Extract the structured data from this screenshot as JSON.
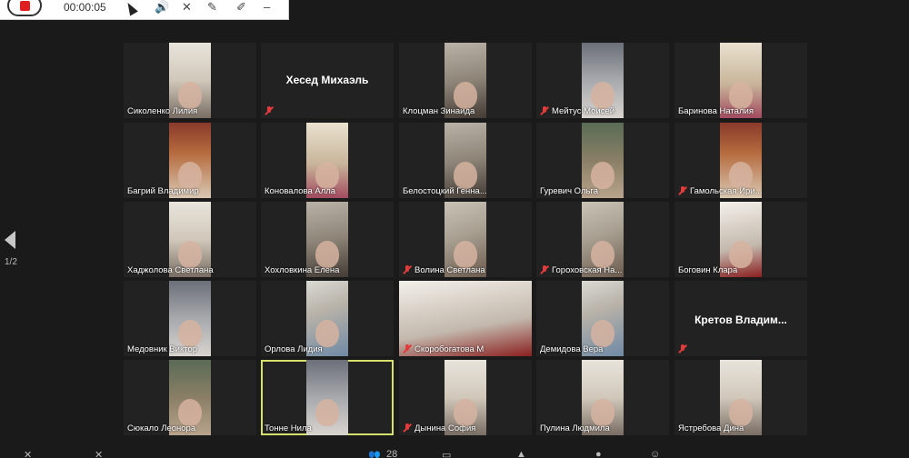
{
  "recording_bar": {
    "timer": "00:00:05",
    "icons": [
      "stop-record-icon",
      "volume-icon",
      "pin-icon",
      "pen-icon",
      "brush-icon",
      "minimize-icon"
    ]
  },
  "pager": {
    "page": "1/2"
  },
  "participants": [
    {
      "name": "Сиколенко Лилия",
      "muted": false,
      "video": "vid-c",
      "vw": 46,
      "vx": 50
    },
    {
      "name": "Хесед Михаэль",
      "muted": true,
      "video": "none",
      "label_center": true
    },
    {
      "name": "Клоцман Зинаида",
      "muted": false,
      "video": "vid-d",
      "vw": 46,
      "vx": 50
    },
    {
      "name": "Мейтус Моисей",
      "muted": true,
      "video": "vid-i",
      "vw": 46,
      "vx": 50
    },
    {
      "name": "Баринова Наталия",
      "muted": false,
      "video": "vid-e",
      "vw": 46,
      "vx": 50
    },
    {
      "name": "Багрий Владимир",
      "muted": false,
      "video": "vid-b",
      "vw": 46,
      "vx": 50
    },
    {
      "name": "Коновалова Алла",
      "muted": false,
      "video": "vid-e",
      "vw": 46,
      "vx": 50
    },
    {
      "name": "Белостоцкий Генна...",
      "muted": false,
      "video": "vid-d",
      "vw": 46,
      "vx": 50
    },
    {
      "name": "Гуревич Ольга",
      "muted": false,
      "video": "vid-h",
      "vw": 46,
      "vx": 50
    },
    {
      "name": "Гамольская Ири...",
      "muted": true,
      "video": "vid-b",
      "vw": 46,
      "vx": 50
    },
    {
      "name": "Хаджолова Светлана",
      "muted": false,
      "video": "vid-c",
      "vw": 46,
      "vx": 50
    },
    {
      "name": "Хохловкина Елена",
      "muted": false,
      "video": "vid-d",
      "vw": 46,
      "vx": 50
    },
    {
      "name": "Волина Светлана",
      "muted": true,
      "video": "vid-a",
      "vw": 46,
      "vx": 50
    },
    {
      "name": "Гороховская На...",
      "muted": true,
      "video": "vid-a",
      "vw": 46,
      "vx": 50
    },
    {
      "name": "Боговин Клара",
      "muted": false,
      "video": "vid-g",
      "vw": 46,
      "vx": 50
    },
    {
      "name": "Медовник Виктор",
      "muted": false,
      "video": "vid-i",
      "vw": 46,
      "vx": 50
    },
    {
      "name": "Орлова Лидия",
      "muted": false,
      "video": "vid-f",
      "vw": 46,
      "vx": 50
    },
    {
      "name": "Скоробогатова М",
      "muted": true,
      "video": "vid-g",
      "vw": 146,
      "vx": 0
    },
    {
      "name": "Демидова Вера",
      "muted": false,
      "video": "vid-f",
      "vw": 46,
      "vx": 50
    },
    {
      "name": "Кретов Владим...",
      "muted": true,
      "video": "none",
      "label_center": true
    },
    {
      "name": "Сюкало Леонора",
      "muted": false,
      "video": "vid-h",
      "vw": 46,
      "vx": 50
    },
    {
      "name": "Тонне Нила",
      "muted": false,
      "video": "vid-i",
      "vw": 46,
      "vx": 50,
      "speaking": true
    },
    {
      "name": "Дынина София",
      "muted": true,
      "video": "vid-c",
      "vw": 46,
      "vx": 50
    },
    {
      "name": "Пулина Людмила",
      "muted": false,
      "video": "vid-c",
      "vw": 46,
      "vx": 50
    },
    {
      "name": "Ястребова Дина",
      "muted": false,
      "video": "vid-c",
      "vw": 46,
      "vx": 50
    }
  ],
  "bottom_toolbar": {
    "participants_count": "28"
  }
}
